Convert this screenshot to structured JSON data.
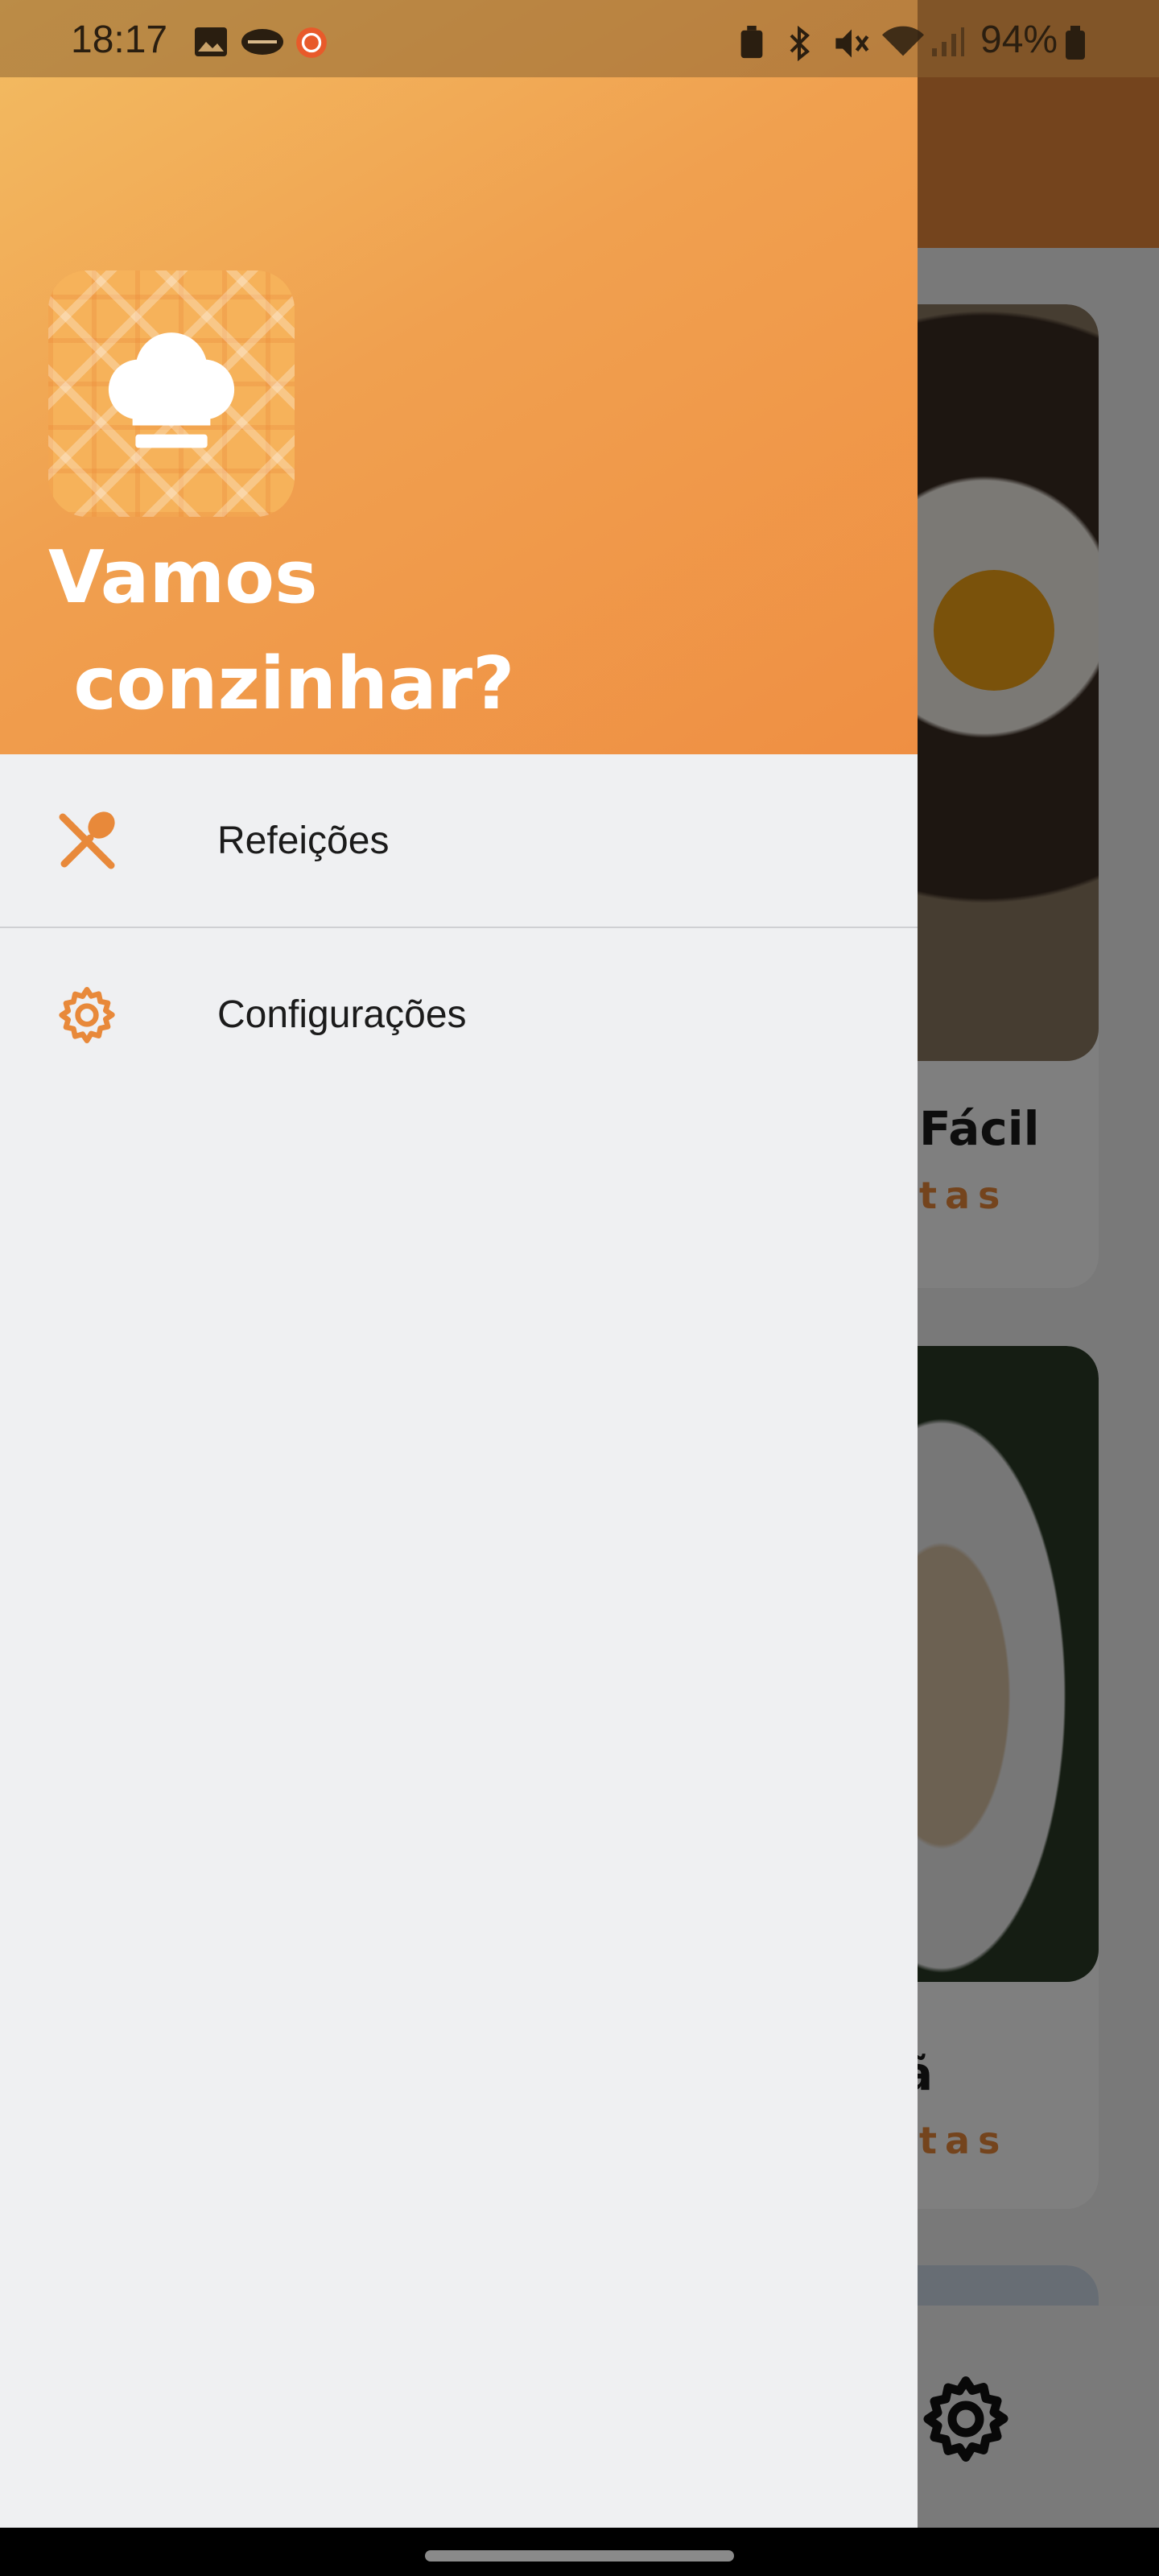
{
  "status_bar": {
    "time": "18:17",
    "battery": "94%",
    "left_icons": [
      "gallery-icon",
      "handshake-icon",
      "recorder-icon"
    ],
    "right_icons": [
      "battery-saver-icon",
      "bluetooth-icon",
      "mute-icon",
      "wifi-icon",
      "signal-icon",
      "battery-icon"
    ]
  },
  "drawer": {
    "title_line1": "Vamos",
    "title_line2": " conzinhar?",
    "logo_icon": "chef-hat-icon",
    "items": [
      {
        "label": "Refeições",
        "icon": "utensils-icon"
      },
      {
        "label": "Configurações",
        "icon": "gear-icon"
      }
    ]
  },
  "background_app": {
    "cards": [
      {
        "title_visible": "Fácil",
        "sub_visible": "tas"
      },
      {
        "title_visible": "ã",
        "sub_visible": "tas"
      }
    ],
    "bottom_nav_icon": "gear-icon"
  },
  "colors": {
    "accent": "#e8893a",
    "header_gradient_start": "#f3bc62",
    "header_gradient_end": "#ef8f43",
    "drawer_bg": "#eff0f2"
  }
}
